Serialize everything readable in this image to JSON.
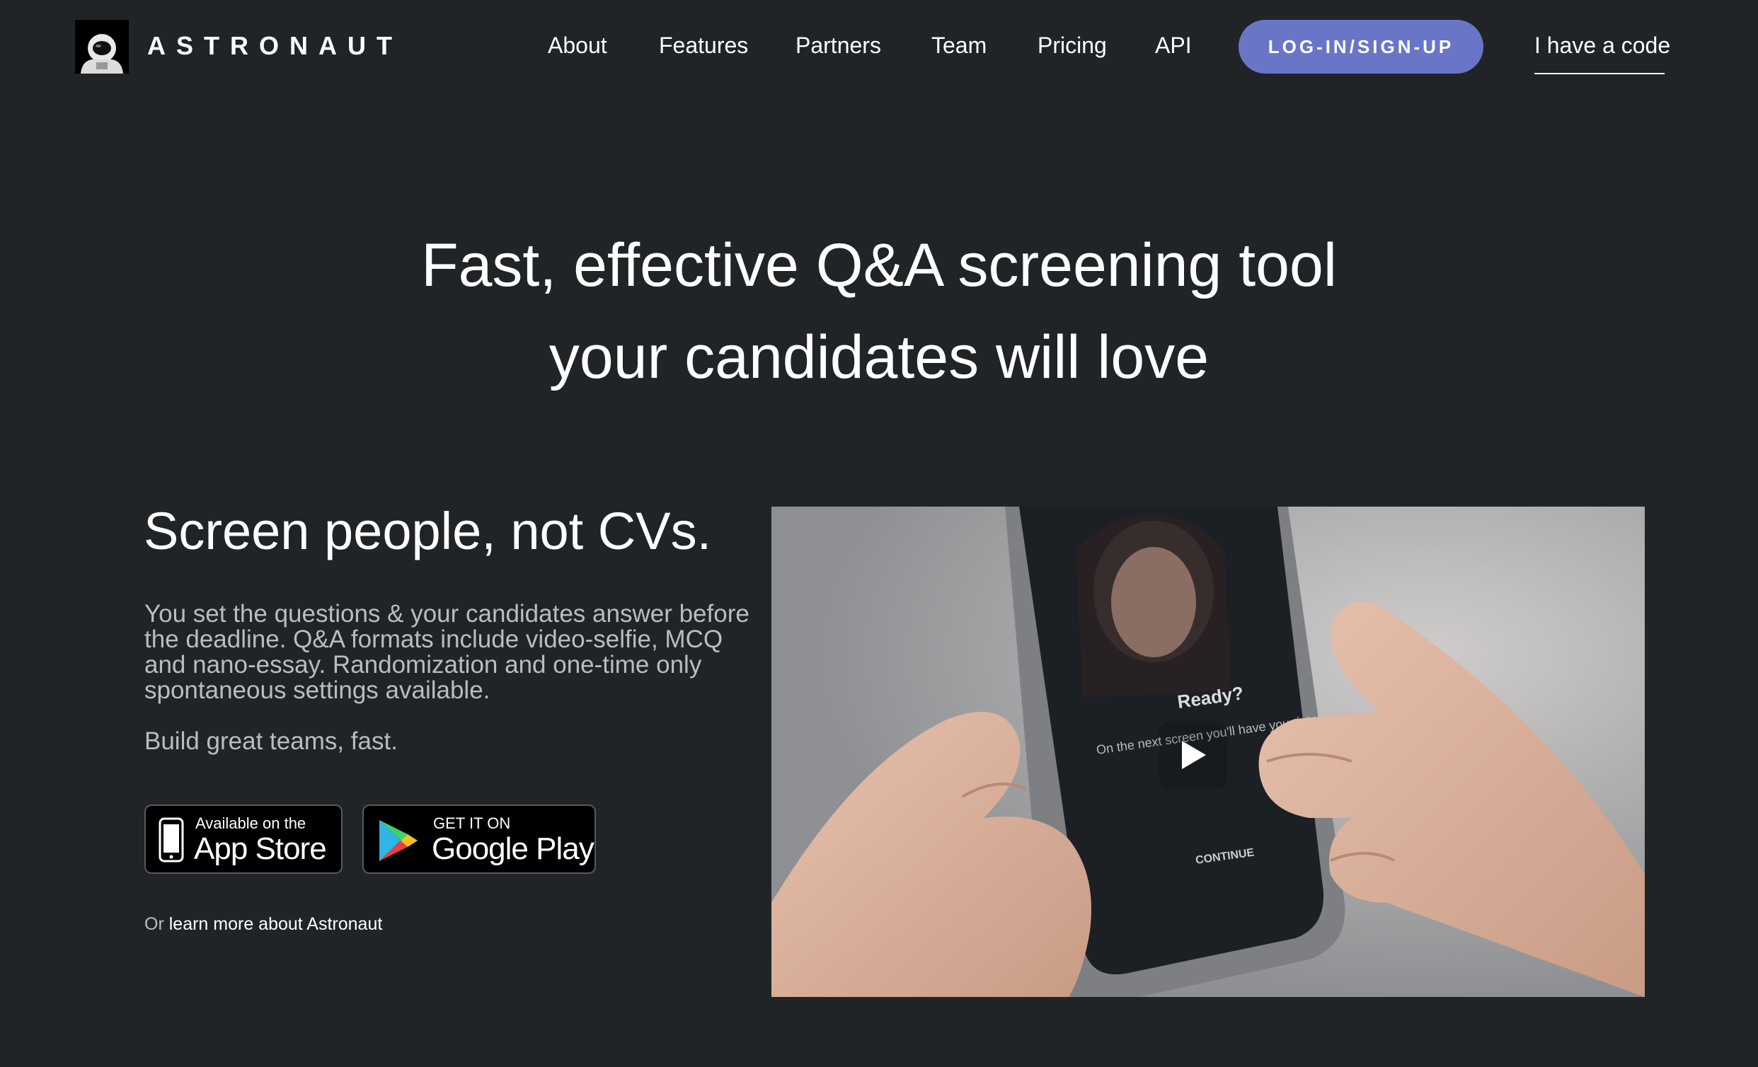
{
  "brand": {
    "name": "ASTRONAUT"
  },
  "nav": {
    "links": [
      "About",
      "Features",
      "Partners",
      "Team",
      "Pricing",
      "API"
    ],
    "login_label": "LOG-IN/SIGN-UP",
    "code_label": "I have a code"
  },
  "hero": {
    "line1": "Fast, effective Q&A screening tool",
    "line2": "your candidates will love"
  },
  "section": {
    "title": "Screen people, not CVs.",
    "description": "You set the questions & your candidates answer before the deadline. Q&A formats include video-selfie, MCQ and nano-essay. Randomization and one-time only spontaneous settings available.",
    "tagline": "Build great teams, fast."
  },
  "stores": {
    "app_store_small": "Available on the",
    "app_store_big": "App Store",
    "google_small": "GET IT ON",
    "google_big": "Google Play"
  },
  "learn": {
    "prefix": "Or",
    "link": "learn more about Astronaut"
  },
  "video": {
    "screen_title": "Ready?",
    "screen_text": "On the next screen you'll have your interview...",
    "screen_button": "CONTINUE"
  },
  "colors": {
    "background": "#212427",
    "accent": "#6975c6",
    "muted_text": "#b9bcc0"
  }
}
